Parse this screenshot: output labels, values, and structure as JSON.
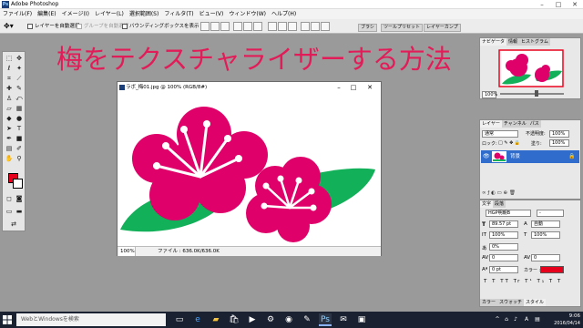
{
  "app": {
    "title": "Adobe Photoshop",
    "logo": "Ps"
  },
  "menu": [
    "ファイル(F)",
    "編集(E)",
    "イメージ(I)",
    "レイヤー(L)",
    "選択範囲(S)",
    "フィルタ(T)",
    "ビュー(V)",
    "ウィンドウ(W)",
    "ヘルプ(H)"
  ],
  "options": {
    "auto_select_layer": "レイヤーを自動選択",
    "auto_select_group": "グループを自動選択",
    "show_bounding_box": "バウンディングボックスを表示",
    "well_tabs": [
      "ブラシ",
      "ツールプリセット",
      "レイヤーカンプ"
    ]
  },
  "heading": "梅をテクスチャライザーする方法",
  "document": {
    "title": "ラボ_梅01.jpg @ 100% (RGB/8#)",
    "zoom": "100%",
    "file_info": "ファイル : 636.0K/636.0K"
  },
  "navigator": {
    "tabs": [
      "ナビゲータ",
      "情報",
      "ヒストグラム"
    ],
    "zoom": "100%"
  },
  "layers": {
    "tabs": [
      "レイヤー",
      "チャンネル",
      "パス"
    ],
    "blend_mode": "通常",
    "opacity_label": "不透明度:",
    "opacity": "100%",
    "lock_label": "ロック:",
    "fill_label": "塗り:",
    "fill": "100%",
    "layer_name": "背景"
  },
  "character": {
    "tabs": [
      "文字",
      "段落"
    ],
    "font": "HGP明朝B",
    "size": "89.57 pt",
    "leading": "自動",
    "vscale": "100%",
    "hscale": "100%",
    "tracking_ratio": "0%",
    "kerning": "0",
    "tracking": "0",
    "baseline": "0 pt",
    "color_label": "カラー :",
    "color": "#e7001c",
    "bottom_tabs": [
      "カラー",
      "スウォッチ",
      "スタイル"
    ]
  },
  "taskbar": {
    "search_placeholder": "WebとWindowsを検索",
    "time": "9:06",
    "date": "2016/04/14",
    "ime": "A"
  },
  "colors": {
    "heading": "#e21c58",
    "flower": "#e0006a",
    "leaf": "#13b05a",
    "foreground": "#e7001c"
  }
}
